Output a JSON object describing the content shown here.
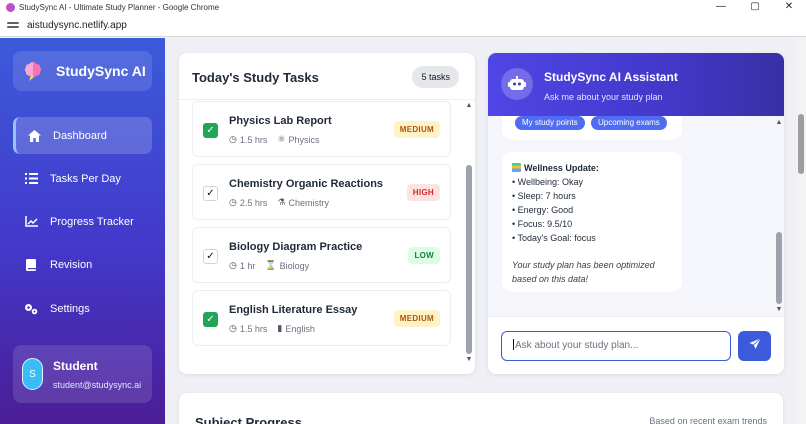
{
  "browser": {
    "window_title": "StudySync AI - Ultimate Study Planner - Google Chrome",
    "url": "aistudysync.netlify.app",
    "controls": [
      "—",
      "▢",
      "✕"
    ]
  },
  "sidebar": {
    "brand": "StudySync AI",
    "items": [
      {
        "label": "Dashboard",
        "icon": "home-icon",
        "active": true
      },
      {
        "label": "Tasks Per Day",
        "icon": "list-icon",
        "active": false
      },
      {
        "label": "Progress Tracker",
        "icon": "chart-line-icon",
        "active": false
      },
      {
        "label": "Revision",
        "icon": "book-icon",
        "active": false
      },
      {
        "label": "Settings",
        "icon": "gear-icon",
        "active": false
      }
    ],
    "user": {
      "initial": "S",
      "name": "Student",
      "email": "student@studysync.ai"
    }
  },
  "tasks": {
    "title": "Today's Study Tasks",
    "count": "5 tasks",
    "items": [
      {
        "name": "Physics Lab Report",
        "duration": "1.5 hrs",
        "subject": "Physics",
        "subject_icon": "atom-icon",
        "priority": "MEDIUM",
        "done": true
      },
      {
        "name": "Chemistry Organic Reactions",
        "duration": "2.5 hrs",
        "subject": "Chemistry",
        "subject_icon": "flask-icon",
        "priority": "HIGH",
        "done": false
      },
      {
        "name": "Biology Diagram Practice",
        "duration": "1 hr",
        "subject": "Biology",
        "subject_icon": "dna-icon",
        "priority": "LOW",
        "done": false
      },
      {
        "name": "English Literature Essay",
        "duration": "1.5 hrs",
        "subject": "English",
        "subject_icon": "book-icon",
        "priority": "MEDIUM",
        "done": true
      }
    ]
  },
  "assistant": {
    "title": "StudySync AI Assistant",
    "subtitle": "Ask me about your study plan",
    "chips": [
      "My study points",
      "Upcoming exams"
    ],
    "wellness": {
      "heading": "Wellness Update:",
      "lines": [
        "• Wellbeing: Okay",
        "• Sleep: 7 hours",
        "• Energy: Good",
        "• Focus: 9.5/10",
        "• Today's Goal: focus"
      ],
      "footer": "Your study plan has been optimized based on this data!"
    },
    "input_placeholder": "Ask about your study plan..."
  },
  "progress": {
    "title": "Subject Progress",
    "subtitle": "Based on recent exam trends"
  },
  "colors": {
    "sidebar_top": "#3b5bdb",
    "sidebar_bottom": "#4c1d95",
    "accent": "#3b5bdb",
    "done_green": "#22a559"
  }
}
